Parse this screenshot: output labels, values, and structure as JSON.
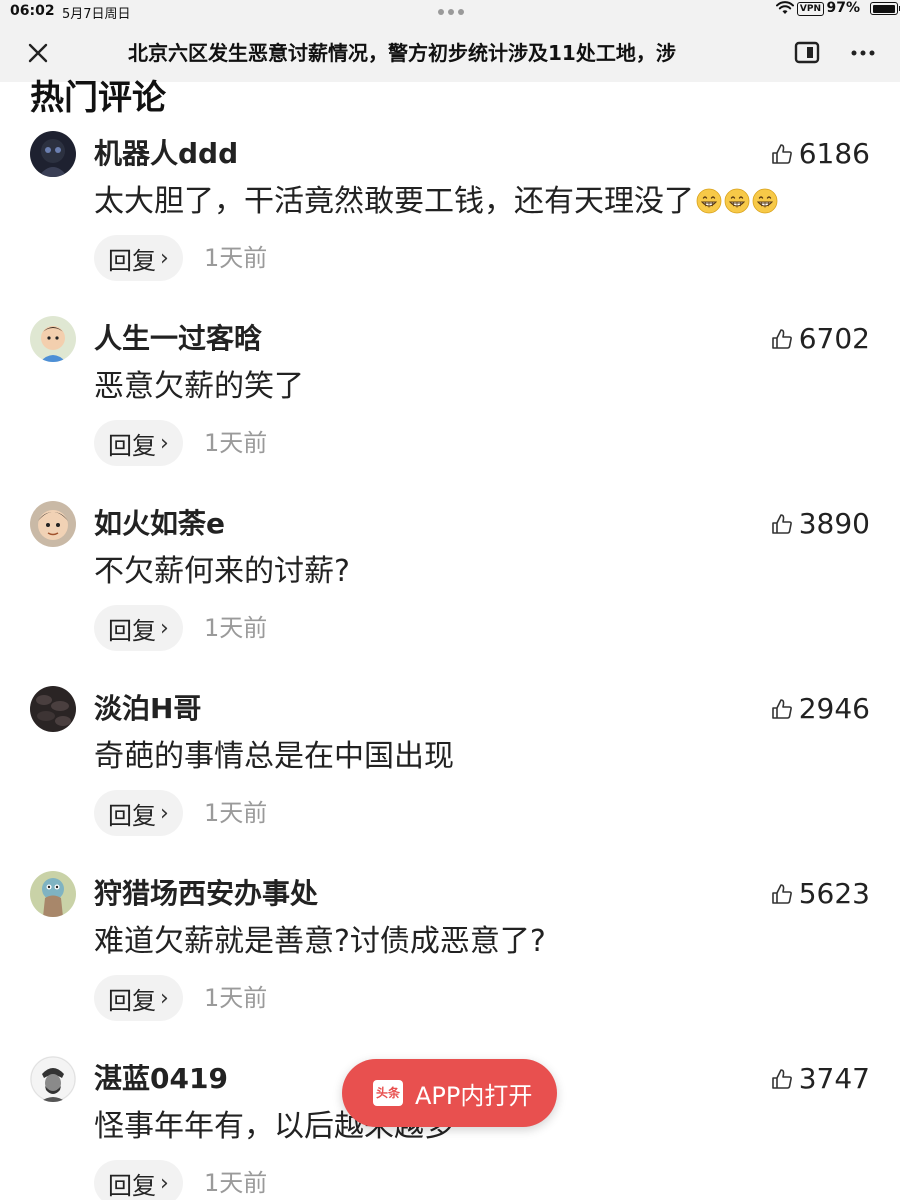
{
  "status_bar": {
    "time": "06:02",
    "date": "5月7日周日",
    "vpn": "VPN",
    "battery": "97%",
    "battery_level": 0.97
  },
  "browser": {
    "title": "北京六区发生恶意讨薪情况，警方初步统计涉及11处工地，涉"
  },
  "section": {
    "heading": "热门评论"
  },
  "comments": [
    {
      "user": "机器人ddd",
      "likes": "6186",
      "text": "太大胆了，干活竟然敢要工钱，还有天理没了",
      "emoji_count": 3,
      "reply": "回复",
      "time": "1天前"
    },
    {
      "user": "人生一过客晗",
      "likes": "6702",
      "text": "恶意欠薪的笑了",
      "reply": "回复",
      "time": "1天前"
    },
    {
      "user": "如火如荼e",
      "likes": "3890",
      "text": "不欠薪何来的讨薪?",
      "reply": "回复",
      "time": "1天前"
    },
    {
      "user": "淡泊H哥",
      "likes": "2946",
      "text": "奇葩的事情总是在中国出现",
      "reply": "回复",
      "time": "1天前"
    },
    {
      "user": "狩猎场西安办事处",
      "likes": "5623",
      "text": "难道欠薪就是善意?讨债成恶意了?",
      "reply": "回复",
      "time": "1天前"
    },
    {
      "user": "湛蓝0419",
      "likes": "3747",
      "text": "怪事年年有，以后越来越多",
      "reply": "回复",
      "time": "1天前"
    }
  ],
  "open_app": {
    "logo_text": "头条",
    "label": "APP内打开",
    "color": "#e8504f"
  },
  "icons": {
    "close": "close-icon",
    "reader": "reader-mode-icon",
    "more": "more-icon",
    "like": "thumbs-up-icon",
    "emoji": "grinning-face-emoji"
  }
}
